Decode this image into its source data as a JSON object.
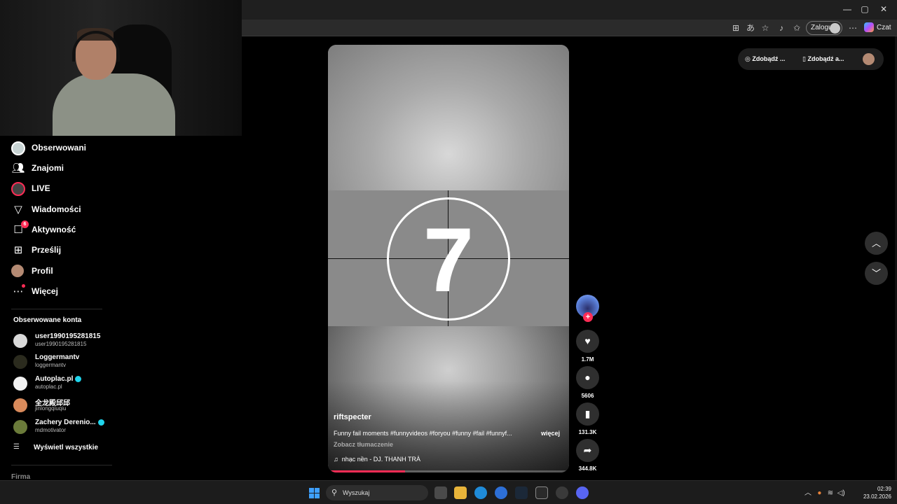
{
  "browser": {
    "window_controls": {
      "minimize": "—",
      "maximize": "▢",
      "close": "✕"
    },
    "login_label": "Zaloguj",
    "chat_label": "Czat"
  },
  "sidebar": {
    "nav": [
      {
        "label": "Obserwowani",
        "icon": "following-icon"
      },
      {
        "label": "Znajomi",
        "icon": "friends-icon"
      },
      {
        "label": "LIVE",
        "icon": "live-icon"
      },
      {
        "label": "Wiadomości",
        "icon": "messages-icon"
      },
      {
        "label": "Aktywność",
        "icon": "activity-icon",
        "badge": "6"
      },
      {
        "label": "Prześlij",
        "icon": "upload-icon"
      },
      {
        "label": "Profil",
        "icon": "profile-icon"
      },
      {
        "label": "Więcej",
        "icon": "more-icon"
      }
    ],
    "followed_title": "Obserwowane konta",
    "accounts": [
      {
        "name": "user1990195281815",
        "handle": "user1990195281815",
        "verified": false,
        "avatar_color": "#d9d9d9"
      },
      {
        "name": "Loggermantv",
        "handle": "loggermantv",
        "verified": false,
        "avatar_color": "#2b2b1e"
      },
      {
        "name": "Autoplac.pl",
        "handle": "autoplac.pl",
        "verified": true,
        "avatar_color": "#f2f2f2"
      },
      {
        "name": "全龙殿邱邱",
        "handle": "jinlongqiuqiu",
        "verified": false,
        "avatar_color": "#d98a5b"
      },
      {
        "name": "Zachery Derenio...",
        "handle": "mdmotivator",
        "verified": true,
        "avatar_color": "#6b7b3a"
      }
    ],
    "see_all": "Wyświetl wszystkie",
    "company": "Firma"
  },
  "video": {
    "countdown": "7",
    "author": "riftspecter",
    "caption": "Funny fail moments #funnyvideos #foryou #funny #fail #funnyf...",
    "more": "więcej",
    "translate": "Zobacz tłumaczenie",
    "music_icon": "♫",
    "music": "nhạc nền - DJ. THANH TRÀ",
    "progress": 0.32
  },
  "actions": {
    "likes": "1.7M",
    "comments": "5606",
    "saves": "131.3K",
    "shares": "344.8K"
  },
  "topbar": {
    "coins": "Zdobądź ...",
    "app": "Zdobądź a..."
  },
  "taskbar": {
    "search": "Wyszukaj",
    "time": "02:39",
    "date": "23.02.2026"
  },
  "colors": {
    "accent": "#fe2c55",
    "verified": "#20d5ec",
    "windows_blue": "#3ea0ff"
  }
}
